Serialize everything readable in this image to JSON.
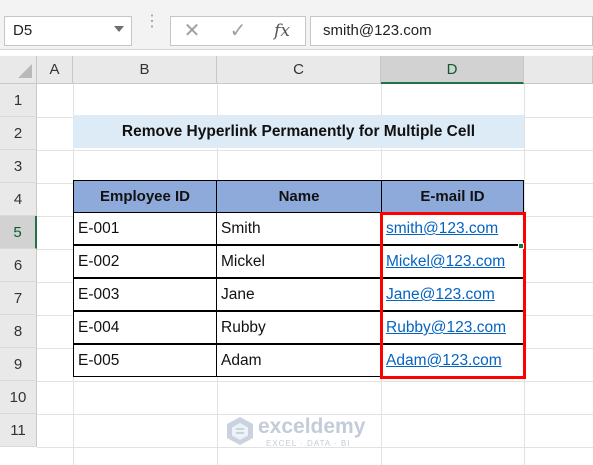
{
  "formula_bar": {
    "name_box": "D5",
    "formula": "smith@123.com",
    "cancel_icon": "✕",
    "enter_icon": "✓",
    "fx_label": "fx"
  },
  "columns": [
    "A",
    "B",
    "C",
    "D"
  ],
  "selected_column": "D",
  "rows": [
    "1",
    "2",
    "3",
    "4",
    "5",
    "6",
    "7",
    "8",
    "9",
    "10",
    "11"
  ],
  "selected_row": "5",
  "sheet": {
    "title": "Remove Hyperlink Permanently for Multiple Cell",
    "headers": [
      "Employee ID",
      "Name",
      "E-mail ID"
    ],
    "records": [
      {
        "id": "E-001",
        "name": "Smith",
        "email": "smith@123.com"
      },
      {
        "id": "E-002",
        "name": "Mickel",
        "email": "Mickel@123.com"
      },
      {
        "id": "E-003",
        "name": "Jane",
        "email": "Jane@123.com"
      },
      {
        "id": "E-004",
        "name": "Rubby",
        "email": "Rubby@123.com"
      },
      {
        "id": "E-005",
        "name": "Adam",
        "email": "Adam@123.com"
      }
    ]
  },
  "watermark": {
    "name": "exceldemy",
    "tagline": "EXCEL · DATA · BI"
  },
  "colors": {
    "header_fill": "#8eaadb",
    "title_fill": "#ddebf7",
    "link": "#0563c1",
    "highlight": "#ff0000",
    "excel_green": "#217346"
  }
}
